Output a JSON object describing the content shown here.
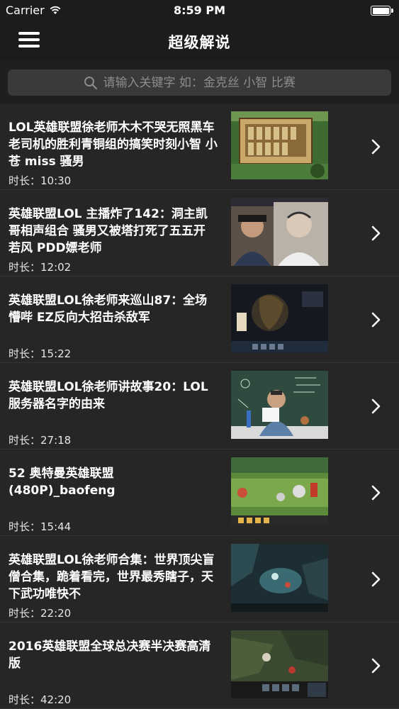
{
  "status_bar": {
    "carrier": "Carrier",
    "time": "8:59 PM"
  },
  "nav": {
    "title": "超级解说",
    "menu_icon": "hamburger-menu-icon"
  },
  "search": {
    "placeholder": "请输入关键字 如：金克丝 小智 比赛"
  },
  "videos": [
    {
      "title": "LOL英雄联盟徐老师木木不哭无照黑车老司机的胜利青铜组的搞笑时刻小智 小苍 miss 骚男",
      "duration": "时长：10:30"
    },
    {
      "title": "英雄联盟LOL 主播炸了142：洞主凯哥相声组合 骚男又被塔打死了五五开 若风 PDD嫖老师",
      "duration": "时长：12:02"
    },
    {
      "title": "英雄联盟LOL徐老师来巡山87：全场懵哔 EZ反向大招击杀敌军",
      "duration": "时长：15:22"
    },
    {
      "title": "英雄联盟LOL徐老师讲故事20：LOL服务器名字的由来",
      "duration": "时长：27:18"
    },
    {
      "title": "52 奥特曼英雄联盟(480P)_baofeng",
      "duration": "时长：15:44"
    },
    {
      "title": "英雄联盟LOL徐老师合集：世界顶尖盲僧合集，跪着看完，世界最秀瞎子，天下武功唯快不",
      "duration": "时长：22:20"
    },
    {
      "title": "2016英雄联盟全球总决赛半决赛高清版",
      "duration": "时长：42:20"
    }
  ]
}
